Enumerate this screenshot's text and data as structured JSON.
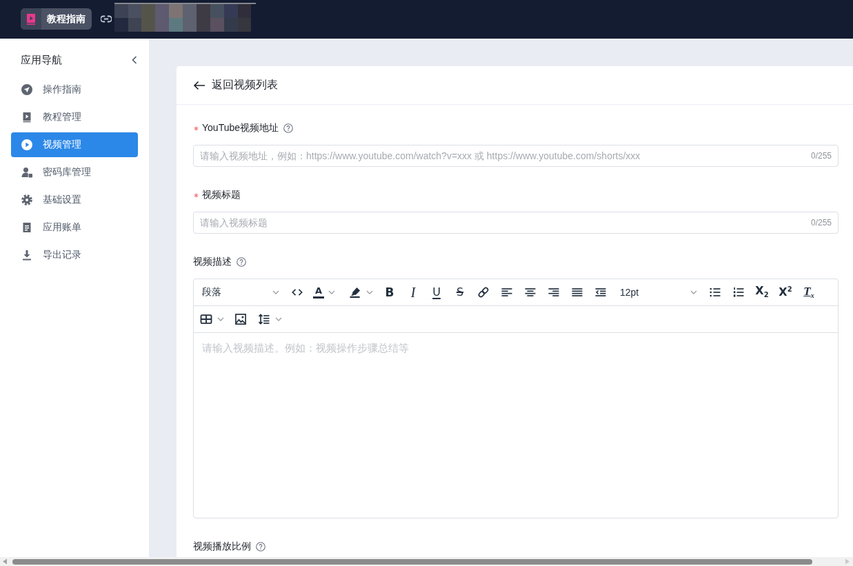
{
  "topbar": {
    "app_name": "教程指南"
  },
  "sidebar": {
    "title": "应用导航",
    "items": [
      {
        "label": "操作指南",
        "selected": false
      },
      {
        "label": "教程管理",
        "selected": false
      },
      {
        "label": "视频管理",
        "selected": true
      },
      {
        "label": "密码库管理",
        "selected": false
      },
      {
        "label": "基础设置",
        "selected": false
      },
      {
        "label": "应用账单",
        "selected": false
      },
      {
        "label": "导出记录",
        "selected": false
      }
    ]
  },
  "page": {
    "back_link": "返回视频列表",
    "fields": [
      {
        "kind": "text",
        "label": "YouTube视频地址",
        "required": true,
        "help": true,
        "placeholder": "请输入视频地址，例如：https://www.youtube.com/watch?v=xxx 或 https://www.youtube.com/shorts/xxx",
        "counter": "0/255"
      },
      {
        "kind": "text",
        "label": "视频标题",
        "required": true,
        "help": false,
        "placeholder": "请输入视频标题",
        "counter": "0/255"
      },
      {
        "kind": "editor",
        "label": "视频描述",
        "required": false,
        "help": true,
        "toolbar": [
          {
            "items": [
              {
                "kind": "select",
                "label": "段落"
              },
              {
                "kind": "code"
              },
              {
                "kind": "color",
                "glyph": "A"
              },
              {
                "kind": "highlight"
              },
              {
                "kind": "bold",
                "glyph": "B"
              },
              {
                "kind": "italic",
                "glyph": "I"
              },
              {
                "kind": "underline",
                "glyph": "U"
              },
              {
                "kind": "strike",
                "glyph": "S"
              },
              {
                "kind": "link"
              },
              {
                "kind": "alignleft"
              },
              {
                "kind": "aligncenter"
              },
              {
                "kind": "alignright"
              },
              {
                "kind": "justify"
              },
              {
                "kind": "outdent"
              },
              {
                "kind": "select",
                "label": "12pt"
              },
              {
                "kind": "bullets"
              },
              {
                "kind": "numbers"
              },
              {
                "kind": "subscript",
                "glyph": "X$_{2}$"
              },
              {
                "kind": "superscript",
                "glyph": "X$^{2}$"
              },
              {
                "kind": "clear",
                "glyph": "T$_{x}$"
              }
            ]
          },
          {
            "items": [
              {
                "kind": "table"
              },
              {
                "kind": "image"
              },
              {
                "kind": "lineheight"
              }
            ]
          }
        ],
        "placeholder": "请输入视频描述。例如：视频操作步骤总结等"
      },
      {
        "kind": "offscreen",
        "label": "视频播放比例",
        "required": false,
        "help": true
      }
    ]
  }
}
